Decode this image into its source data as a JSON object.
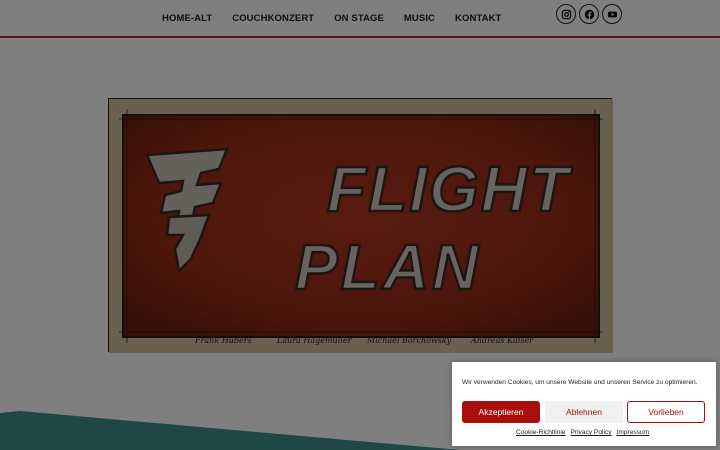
{
  "nav": {
    "items": [
      {
        "label": "HOME-ALT"
      },
      {
        "label": "COUCHKONZERT"
      },
      {
        "label": "ON STAGE"
      },
      {
        "label": "MUSIC"
      },
      {
        "label": "KONTAKT"
      }
    ]
  },
  "social": {
    "icons": [
      "instagram-icon",
      "facebook-icon",
      "youtube-icon"
    ]
  },
  "banner": {
    "logo_line1": "FLIGHT",
    "logo_line2": "PLAN",
    "signatures": [
      "Frank Hubers",
      "Laura Hagemüller",
      "Michael Borchowsky",
      "Andreas Kaiser"
    ]
  },
  "colors": {
    "accent": "#ab0c0c",
    "header_line": "#a32a2a",
    "banner_red": "#a5301c",
    "band_teal": "#3f8f8a"
  },
  "cookie": {
    "message": "Wir verwenden Cookies, um unsere Website und unseren Service zu optimieren.",
    "accept_label": "Akzeptieren",
    "deny_label": "Ablehnen",
    "prefs_label": "Vorlieben",
    "links": [
      "Cookie-Richtlinie",
      "Privacy Policy",
      "Impressum"
    ]
  }
}
